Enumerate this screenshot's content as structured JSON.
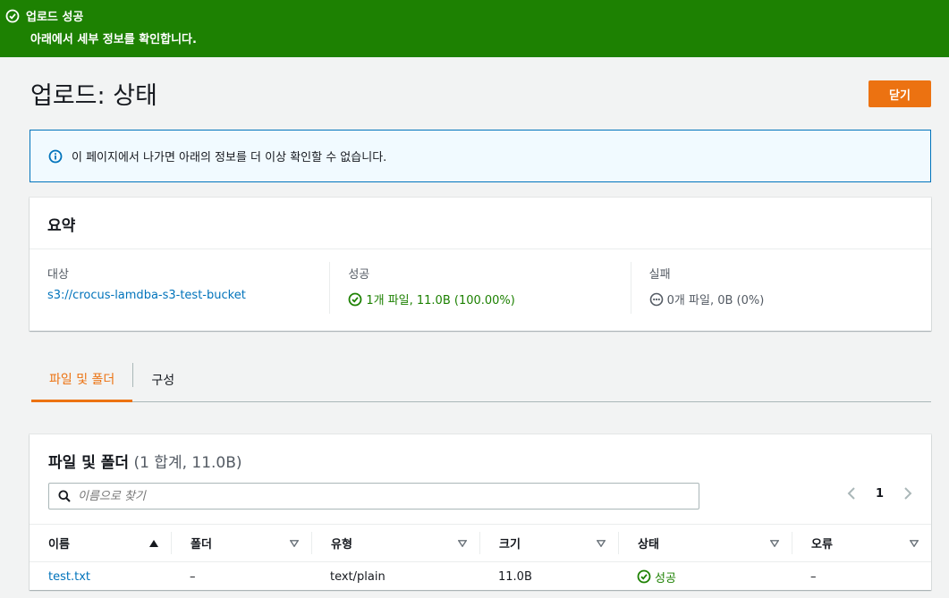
{
  "flash": {
    "title": "업로드 성공",
    "message": "아래에서 세부 정보를 확인합니다.",
    "icon": "check-circle-icon",
    "color": "#1d8102"
  },
  "header": {
    "title": "업로드: 상태",
    "close_label": "닫기"
  },
  "info": {
    "icon": "info-circle-icon",
    "text": "이 페이지에서 나가면 아래의 정보를 더 이상 확인할 수 없습니다."
  },
  "summary": {
    "title": "요약",
    "target": {
      "label": "대상",
      "value": "s3://crocus-lamdba-s3-test-bucket"
    },
    "success": {
      "label": "성공",
      "value": "1개 파일, 11.0B (100.00%)"
    },
    "failure": {
      "label": "실패",
      "value": "0개 파일, 0B (0%)"
    }
  },
  "tabs": [
    {
      "label": "파일 및 폴더",
      "active": true
    },
    {
      "label": "구성",
      "active": false
    }
  ],
  "files": {
    "title": "파일 및 폴더",
    "count": "(1 합계, 11.0B)",
    "search_placeholder": "이름으로 찾기",
    "page": "1",
    "columns": [
      "이름",
      "폴더",
      "유형",
      "크기",
      "상태",
      "오류"
    ],
    "rows": [
      {
        "name": "test.txt",
        "folder": "–",
        "type": "text/plain",
        "size": "11.0B",
        "status": "성공",
        "error": "–"
      }
    ]
  },
  "colors": {
    "accent": "#ec7211",
    "link": "#0073bb",
    "success": "#1d8102"
  }
}
